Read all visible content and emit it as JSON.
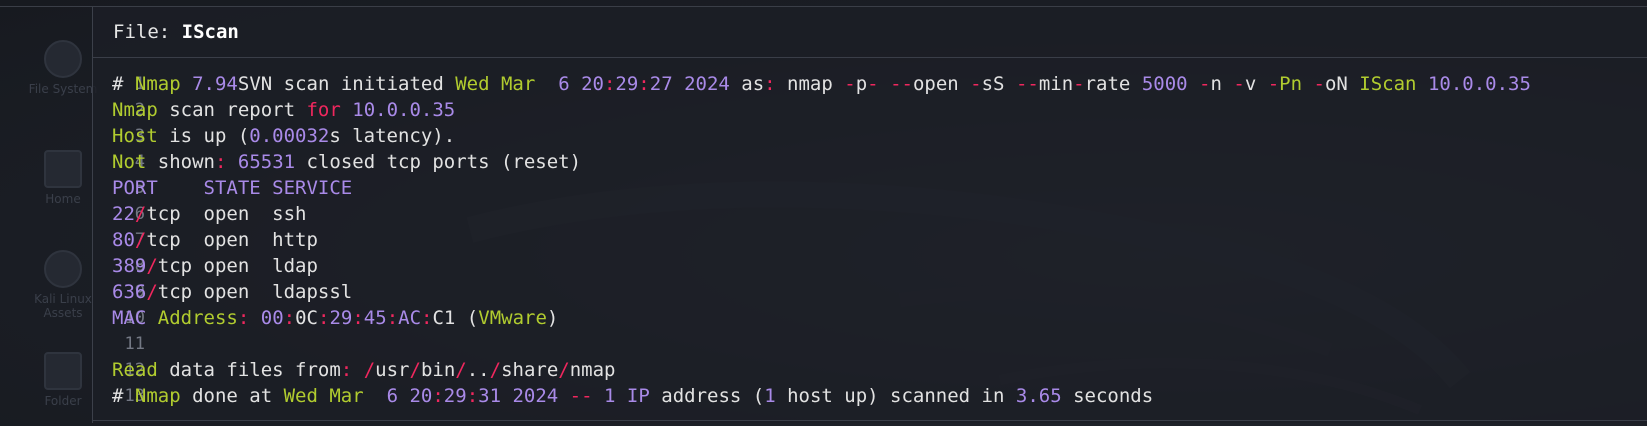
{
  "file_header": {
    "prefix": "File: ",
    "name": "IScan"
  },
  "desktop_icons": [
    {
      "label": "File System",
      "icon": "drive-icon"
    },
    {
      "label": "Home",
      "icon": "home-folder-icon"
    },
    {
      "label": "Kali Linux Assets",
      "icon": "kali-logo-icon"
    },
    {
      "label": "Folder",
      "icon": "folder-icon"
    }
  ],
  "line_numbers": [
    "1",
    "2",
    "3",
    "4",
    "5",
    "6",
    "7",
    "8",
    "9",
    "10",
    "11",
    "12",
    "13"
  ],
  "lines": [
    [
      [
        "w",
        "# "
      ],
      [
        "g",
        "Nmap"
      ],
      [
        "w",
        " "
      ],
      [
        "p",
        "7.94"
      ],
      [
        "w",
        "SVN scan initiated "
      ],
      [
        "g",
        "Wed Mar"
      ],
      [
        "w",
        "  "
      ],
      [
        "p",
        "6 20"
      ],
      [
        "r",
        ":"
      ],
      [
        "p",
        "29"
      ],
      [
        "r",
        ":"
      ],
      [
        "p",
        "27 2024"
      ],
      [
        "w",
        " as"
      ],
      [
        "r",
        ":"
      ],
      [
        "w",
        " nmap "
      ],
      [
        "r",
        "-"
      ],
      [
        "w",
        "p"
      ],
      [
        "r",
        "-"
      ],
      [
        "w",
        " "
      ],
      [
        "r",
        "--"
      ],
      [
        "w",
        "open "
      ],
      [
        "r",
        "-"
      ],
      [
        "w",
        "sS "
      ],
      [
        "r",
        "--"
      ],
      [
        "w",
        "min"
      ],
      [
        "r",
        "-"
      ],
      [
        "w",
        "rate "
      ],
      [
        "p",
        "5000"
      ],
      [
        "w",
        " "
      ],
      [
        "r",
        "-"
      ],
      [
        "w",
        "n "
      ],
      [
        "r",
        "-"
      ],
      [
        "w",
        "v "
      ],
      [
        "r",
        "-"
      ],
      [
        "g",
        "Pn"
      ],
      [
        "w",
        " "
      ],
      [
        "r",
        "-"
      ],
      [
        "w",
        "oN "
      ],
      [
        "g",
        "IScan"
      ],
      [
        "w",
        " "
      ],
      [
        "p",
        "10.0.0.35"
      ]
    ],
    [
      [
        "g",
        "Nmap"
      ],
      [
        "w",
        " scan report "
      ],
      [
        "r",
        "for"
      ],
      [
        "w",
        " "
      ],
      [
        "p",
        "10.0.0.35"
      ]
    ],
    [
      [
        "g",
        "Host"
      ],
      [
        "w",
        " is up ("
      ],
      [
        "p",
        "0.00032"
      ],
      [
        "w",
        "s latency)."
      ]
    ],
    [
      [
        "g",
        "Not"
      ],
      [
        "w",
        " shown"
      ],
      [
        "r",
        ":"
      ],
      [
        "w",
        " "
      ],
      [
        "p",
        "65531"
      ],
      [
        "w",
        " closed tcp ports (reset)"
      ]
    ],
    [
      [
        "p",
        "PORT    STATE SERVICE"
      ]
    ],
    [
      [
        "p",
        "22"
      ],
      [
        "r",
        "/"
      ],
      [
        "w",
        "tcp  open  ssh"
      ]
    ],
    [
      [
        "p",
        "80"
      ],
      [
        "r",
        "/"
      ],
      [
        "w",
        "tcp  open  http"
      ]
    ],
    [
      [
        "p",
        "389"
      ],
      [
        "r",
        "/"
      ],
      [
        "w",
        "tcp open  ldap"
      ]
    ],
    [
      [
        "p",
        "636"
      ],
      [
        "r",
        "/"
      ],
      [
        "w",
        "tcp open  ldapssl"
      ]
    ],
    [
      [
        "p",
        "MAC"
      ],
      [
        "w",
        " "
      ],
      [
        "g",
        "Address"
      ],
      [
        "r",
        ":"
      ],
      [
        "w",
        " "
      ],
      [
        "p",
        "00"
      ],
      [
        "r",
        ":"
      ],
      [
        "w",
        "0C"
      ],
      [
        "r",
        ":"
      ],
      [
        "p",
        "29"
      ],
      [
        "r",
        ":"
      ],
      [
        "p",
        "45"
      ],
      [
        "r",
        ":"
      ],
      [
        "p",
        "AC"
      ],
      [
        "r",
        ":"
      ],
      [
        "w",
        "C1 ("
      ],
      [
        "g",
        "VMware"
      ],
      [
        "w",
        ")"
      ]
    ],
    [
      [
        "w",
        " "
      ]
    ],
    [
      [
        "g",
        "Read"
      ],
      [
        "w",
        " data files from"
      ],
      [
        "r",
        ":"
      ],
      [
        "w",
        " "
      ],
      [
        "r",
        "/"
      ],
      [
        "w",
        "usr"
      ],
      [
        "r",
        "/"
      ],
      [
        "w",
        "bin"
      ],
      [
        "r",
        "/"
      ],
      [
        "w",
        ".."
      ],
      [
        "r",
        "/"
      ],
      [
        "w",
        "share"
      ],
      [
        "r",
        "/"
      ],
      [
        "w",
        "nmap"
      ]
    ],
    [
      [
        "w",
        "# "
      ],
      [
        "g",
        "Nmap"
      ],
      [
        "w",
        " done at "
      ],
      [
        "g",
        "Wed Mar"
      ],
      [
        "w",
        "  "
      ],
      [
        "p",
        "6 20"
      ],
      [
        "r",
        ":"
      ],
      [
        "p",
        "29"
      ],
      [
        "r",
        ":"
      ],
      [
        "p",
        "31 2024"
      ],
      [
        "w",
        " "
      ],
      [
        "r",
        "--"
      ],
      [
        "w",
        " "
      ],
      [
        "p",
        "1"
      ],
      [
        "w",
        " "
      ],
      [
        "p",
        "IP"
      ],
      [
        "w",
        " address ("
      ],
      [
        "p",
        "1"
      ],
      [
        "w",
        " host up) scanned in "
      ],
      [
        "p",
        "3.65"
      ],
      [
        "w",
        " seconds"
      ]
    ]
  ],
  "colors": {
    "white": "#e2e2e2",
    "green": "#b1cc2f",
    "purple": "#a98ae8",
    "red": "#f0275e",
    "line_number": "#737884",
    "background": "#1c1f26"
  }
}
